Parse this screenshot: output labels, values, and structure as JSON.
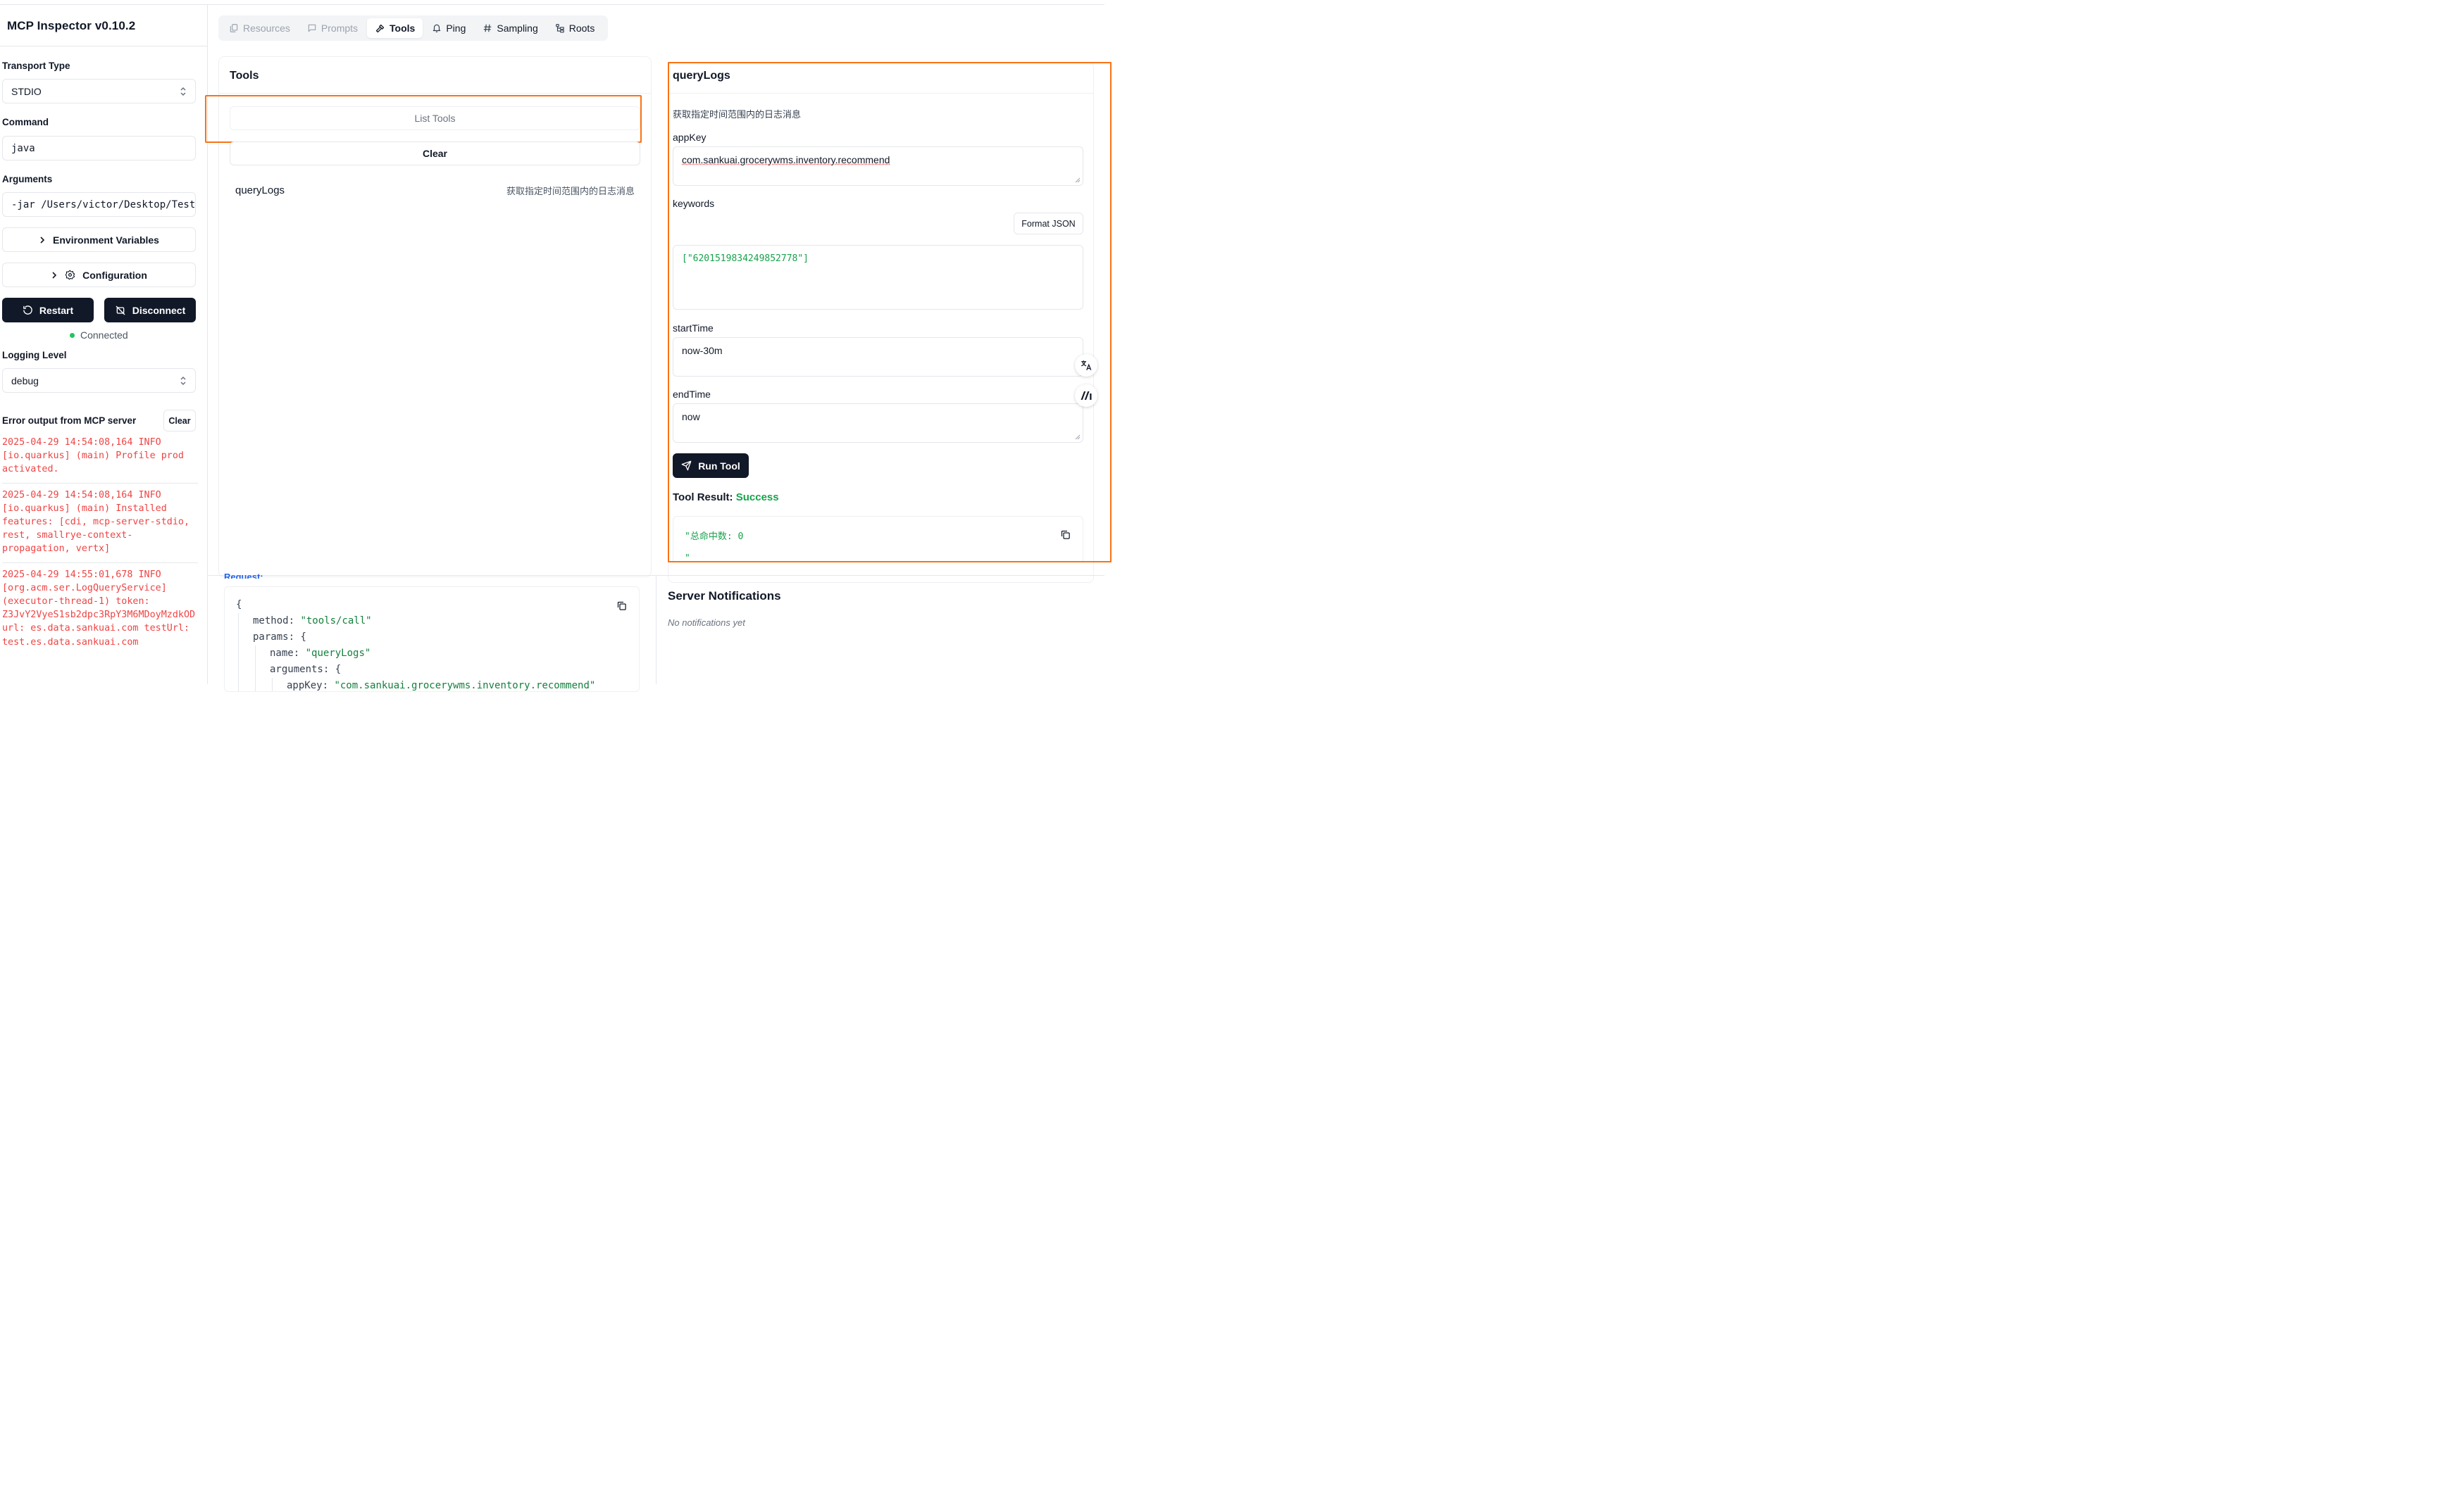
{
  "app": {
    "title": "MCP Inspector v0.10.2"
  },
  "sidebar": {
    "transport_label": "Transport Type",
    "transport_value": "STDIO",
    "command_label": "Command",
    "command_value": "java",
    "arguments_label": "Arguments",
    "arguments_value": "-jar /Users/victor/Desktop/Test",
    "env_button": "Environment Variables",
    "config_button": "Configuration",
    "restart_button": "Restart",
    "disconnect_button": "Disconnect",
    "status_text": "Connected",
    "logging_label": "Logging Level",
    "logging_value": "debug",
    "error_output_label": "Error output from MCP server",
    "clear_button": "Clear",
    "logs": [
      "2025-04-29 14:54:08,164 INFO\n[io.quarkus] (main) Profile prod\nactivated.",
      "2025-04-29 14:54:08,164 INFO\n[io.quarkus] (main) Installed\nfeatures: [cdi, mcp-server-stdio,\nrest, smallrye-context-\npropagation, vertx]",
      "2025-04-29 14:55:01,678 INFO\n[org.acm.ser.LogQueryService]\n(executor-thread-1) token:\nZ3JvY2VyeS1sb2dpc3RpY3M6MDoyMzdkOD\nurl: es.data.sankuai.com testUrl:\ntest.es.data.sankuai.com"
    ]
  },
  "tabs": [
    {
      "label": "Resources",
      "icon": "files-icon"
    },
    {
      "label": "Prompts",
      "icon": "message-square-icon"
    },
    {
      "label": "Tools",
      "icon": "hammer-icon"
    },
    {
      "label": "Ping",
      "icon": "bell-icon"
    },
    {
      "label": "Sampling",
      "icon": "hash-icon"
    },
    {
      "label": "Roots",
      "icon": "folder-tree-icon"
    }
  ],
  "tools_panel": {
    "title": "Tools",
    "list_button": "List Tools",
    "clear_button": "Clear",
    "tool_name": "queryLogs",
    "tool_description": "获取指定时间范围内的日志消息"
  },
  "tool_detail": {
    "title": "queryLogs",
    "description": "获取指定时间范围内的日志消息",
    "appkey_label": "appKey",
    "appkey_value": "com.sankuai.grocerywms.inventory.recommend",
    "keywords_label": "keywords",
    "format_json_button": "Format JSON",
    "keywords_value": "[\"6201519834249852778\"]",
    "starttime_label": "startTime",
    "starttime_value": "now-30m",
    "endtime_label": "endTime",
    "endtime_value": "now",
    "run_button": "Run Tool",
    "result_label": "Tool Result:",
    "result_status": "Success",
    "result_text": "\"总命中数: 0",
    "result_text_2": "\""
  },
  "request": {
    "label": "Request:",
    "lines": [
      {
        "indent": 0,
        "key": "",
        "value": "{"
      },
      {
        "indent": 1,
        "key": "method:",
        "value": "\"tools/call\""
      },
      {
        "indent": 1,
        "key": "params:",
        "value": "{"
      },
      {
        "indent": 2,
        "key": "name:",
        "value": "\"queryLogs\""
      },
      {
        "indent": 2,
        "key": "arguments:",
        "value": "{"
      },
      {
        "indent": 3,
        "key": "appKey:",
        "value": "\"com.sankuai.grocerywms.inventory.recommend\""
      }
    ]
  },
  "notifications": {
    "title": "Server Notifications",
    "empty_text": "No notifications yet"
  },
  "colors": {
    "highlight": "#f97316",
    "success": "#16a34a",
    "error_log": "#ef4444",
    "dark_button": "#111827"
  }
}
